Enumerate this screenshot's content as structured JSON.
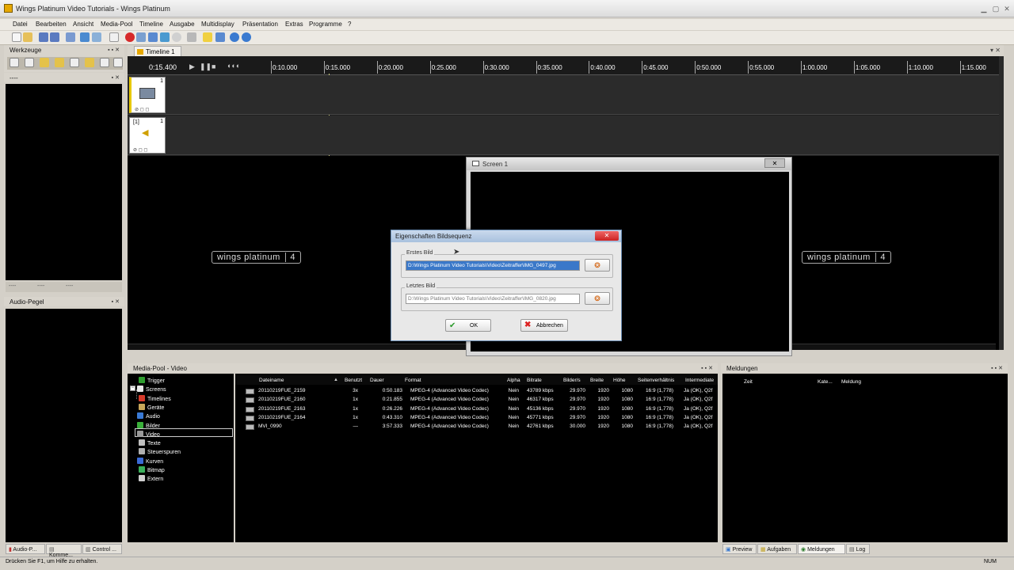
{
  "window": {
    "title": "Wings Platinum Video Tutorials - Wings Platinum"
  },
  "menu": [
    "Datei",
    "Bearbeiten",
    "Ansicht",
    "Media-Pool",
    "Timeline",
    "Ausgabe",
    "Multidisplay",
    "Präsentation",
    "Extras",
    "Programme",
    "?"
  ],
  "panels": {
    "werkzeuge": "Werkzeuge",
    "second_panel": "----",
    "audio_pegel": "Audio-Pegel",
    "panel_tabs": [
      "----",
      "----",
      "----"
    ],
    "media_pool": "Media-Pool - Video",
    "meldungen": "Meldungen"
  },
  "timeline": {
    "tab": "Timeline 1",
    "current_time": "0:15.400",
    "ruler": [
      "0:10.000",
      "0:15.000",
      "0:20.000",
      "0:25.000",
      "0:30.000",
      "0:35.000",
      "0:40.000",
      "0:45.000",
      "0:50.000",
      "0:55.000",
      "1:00.000",
      "1:05.000",
      "1:10.000",
      "1:15.000"
    ],
    "track1_number": "1",
    "track2_number": "1",
    "track2_label": "[1]",
    "logo": "wings platinum",
    "logo_version": "4"
  },
  "screen": {
    "title": "Screen 1"
  },
  "dialog": {
    "title": "Eigenschaften Bildsequenz",
    "first_label": "Erstes Bild",
    "first_path": "D:\\Wings Platinum Video Tutorials\\Video\\Zeitraffer\\IMG_0497.jpg",
    "last_label": "Letztes Bild",
    "last_path": "D:\\Wings Platinum Video Tutorials\\Video\\Zeitraffer\\IMG_0820.jpg",
    "ok": "OK",
    "cancel": "Abbrechen"
  },
  "media_tree": [
    {
      "label": "Trigger",
      "color": "#2e9e2e"
    },
    {
      "label": "Screens",
      "color": "#e8e8e8"
    },
    {
      "label": "Timelines",
      "color": "#d63a2a"
    },
    {
      "label": "Geräte",
      "color": "#c8a85a"
    },
    {
      "label": "Audio",
      "color": "#3a7ad6"
    },
    {
      "label": "Bilder",
      "color": "#3ab03a"
    },
    {
      "label": "Video",
      "color": "#9a9a9a"
    },
    {
      "label": "Texte",
      "color": "#c0c0c0"
    },
    {
      "label": "Steuerspuren",
      "color": "#b0b0b0"
    },
    {
      "label": "Kurven",
      "color": "#3a6ad6"
    },
    {
      "label": "Bitmap",
      "color": "#3ab05a"
    },
    {
      "label": "Extern",
      "color": "#d0d0d0"
    }
  ],
  "media_columns": [
    "Dateiname",
    "Benutzt",
    "Dauer",
    "Format",
    "Alpha",
    "Bitrate",
    "Bilder/s",
    "Breite",
    "Höhe",
    "Seitenverhältnis",
    "Intermediate"
  ],
  "media_rows": [
    [
      "20110219FUE_2159",
      "3x",
      "0:50.183",
      "MPEG-4 (Advanced Video Codec)",
      "Nein",
      "43789 kbps",
      "29.970",
      "1920",
      "1080",
      "16:9 (1,778)",
      "Ja (OK), Q2f"
    ],
    [
      "20110219FUE_2160",
      "1x",
      "0:21.855",
      "MPEG-4 (Advanced Video Codec)",
      "Nein",
      "46317 kbps",
      "29.970",
      "1920",
      "1080",
      "16:9 (1,778)",
      "Ja (OK), Q2f"
    ],
    [
      "20110219FUE_2163",
      "1x",
      "0:26.226",
      "MPEG-4 (Advanced Video Codec)",
      "Nein",
      "45136 kbps",
      "29.970",
      "1920",
      "1080",
      "16:9 (1,778)",
      "Ja (OK), Q2f"
    ],
    [
      "20110219FUE_2164",
      "1x",
      "0:43.310",
      "MPEG-4 (Advanced Video Codec)",
      "Nein",
      "45771 kbps",
      "29.970",
      "1920",
      "1080",
      "16:9 (1,778)",
      "Ja (OK), Q2f"
    ],
    [
      "MVI_0990",
      "—",
      "3:57.333",
      "MPEG-4 (Advanced Video Codec)",
      "Nein",
      "42761 kbps",
      "30.000",
      "1920",
      "1080",
      "16:9 (1,778)",
      "Ja (OK), Q2f"
    ]
  ],
  "meldungen_columns": [
    "Zeit",
    "Kate...",
    "Meldung"
  ],
  "left_bottom_tabs": [
    "Audio-P...",
    "Komme...",
    "Control ..."
  ],
  "right_bottom_tabs": [
    "Preview",
    "Aufgaben",
    "Meldungen",
    "Log"
  ],
  "status": {
    "text": "Drücken Sie F1, um Hilfe zu erhalten.",
    "num": "NUM"
  }
}
